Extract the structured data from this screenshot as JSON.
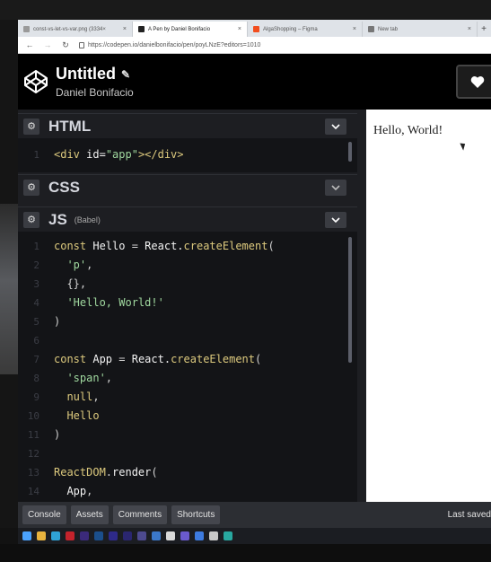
{
  "browser": {
    "tabs": [
      {
        "label": "const-vs-let-vs-var.png (3334×",
        "icon": "file-icon",
        "color": "#9a9a9a",
        "active": false
      },
      {
        "label": "A Pen by Daniel Bonifacio",
        "icon": "codepen-icon",
        "color": "#222222",
        "active": true
      },
      {
        "label": "AlgaShopping – Figma",
        "icon": "figma-icon",
        "color": "#f24e1e",
        "active": false
      },
      {
        "label": "New tab",
        "icon": "tab-icon",
        "color": "#777777",
        "active": false
      }
    ],
    "new_tab_label": "+",
    "close_label": "×",
    "back": "←",
    "forward": "→",
    "reload": "↻",
    "url": "https://codepen.io/danielbonifacio/pen/poyLNzE?editors=1010"
  },
  "header": {
    "title": "Untitled",
    "author": "Daniel Bonifacio"
  },
  "panels": {
    "html": {
      "title": "HTML",
      "sub": ""
    },
    "css": {
      "title": "CSS",
      "sub": ""
    },
    "js": {
      "title": "JS",
      "sub": "(Babel)"
    }
  },
  "html_code": [
    {
      "n": "1",
      "parts": [
        [
          "tag",
          "<div "
        ],
        [
          "attr",
          "id="
        ],
        [
          "str",
          "\"app\""
        ],
        [
          "tag",
          "></div>"
        ]
      ]
    }
  ],
  "js_code": [
    {
      "n": "1",
      "parts": [
        [
          "kw",
          "const "
        ],
        [
          "attr",
          "Hello "
        ],
        [
          "punc",
          "= "
        ],
        [
          "attr",
          "React."
        ],
        [
          "fn",
          "createElement"
        ],
        [
          "punc",
          "("
        ]
      ]
    },
    {
      "n": "2",
      "parts": [
        [
          "str",
          "  'p'"
        ],
        [
          "punc",
          ","
        ]
      ]
    },
    {
      "n": "3",
      "parts": [
        [
          "punc",
          "  {},"
        ]
      ]
    },
    {
      "n": "4",
      "parts": [
        [
          "str",
          "  'Hello, World!'"
        ]
      ]
    },
    {
      "n": "5",
      "parts": [
        [
          "punc",
          ")"
        ]
      ]
    },
    {
      "n": "6",
      "parts": []
    },
    {
      "n": "7",
      "parts": [
        [
          "kw",
          "const "
        ],
        [
          "attr",
          "App "
        ],
        [
          "punc",
          "= "
        ],
        [
          "attr",
          "React."
        ],
        [
          "fn",
          "createElement"
        ],
        [
          "punc",
          "("
        ]
      ]
    },
    {
      "n": "8",
      "parts": [
        [
          "str",
          "  'span'"
        ],
        [
          "punc",
          ","
        ]
      ]
    },
    {
      "n": "9",
      "parts": [
        [
          "kw",
          "  null"
        ],
        [
          "punc",
          ","
        ]
      ]
    },
    {
      "n": "10",
      "parts": [
        [
          "kw",
          "  Hello"
        ]
      ]
    },
    {
      "n": "11",
      "parts": [
        [
          "punc",
          ")"
        ]
      ]
    },
    {
      "n": "12",
      "parts": []
    },
    {
      "n": "13",
      "parts": [
        [
          "fn",
          "ReactDOM"
        ],
        [
          "punc",
          "."
        ],
        [
          "attr",
          "render"
        ],
        [
          "punc",
          "("
        ]
      ]
    },
    {
      "n": "14",
      "parts": [
        [
          "attr",
          "  App"
        ],
        [
          "punc",
          ","
        ]
      ]
    }
  ],
  "preview": {
    "text": "Hello, World!"
  },
  "footer": {
    "buttons": [
      "Console",
      "Assets",
      "Comments",
      "Shortcuts"
    ],
    "status": "Last saved"
  },
  "taskbar": {
    "icons": [
      {
        "name": "windows-start-icon",
        "color": "#4aa3ff"
      },
      {
        "name": "file-explorer-icon",
        "color": "#e8b33e"
      },
      {
        "name": "browser-icon",
        "color": "#2fa3d6"
      },
      {
        "name": "acrobat-icon",
        "color": "#c4232c"
      },
      {
        "name": "premiere-icon",
        "color": "#3b2a7a"
      },
      {
        "name": "photoshop-icon",
        "color": "#1b4f8c"
      },
      {
        "name": "premiere-rush-icon",
        "color": "#2e2a8a"
      },
      {
        "name": "after-effects-icon",
        "color": "#2a2670"
      },
      {
        "name": "app-icon",
        "color": "#4d4a8e"
      },
      {
        "name": "photos-icon",
        "color": "#3b78c9"
      },
      {
        "name": "chrome-icon",
        "color": "#d9d9d9"
      },
      {
        "name": "app2-icon",
        "color": "#6a5acd"
      },
      {
        "name": "todo-icon",
        "color": "#3d7be0"
      },
      {
        "name": "notes-icon",
        "color": "#c8c8c8"
      },
      {
        "name": "edge-icon",
        "color": "#28a8a0"
      }
    ]
  }
}
